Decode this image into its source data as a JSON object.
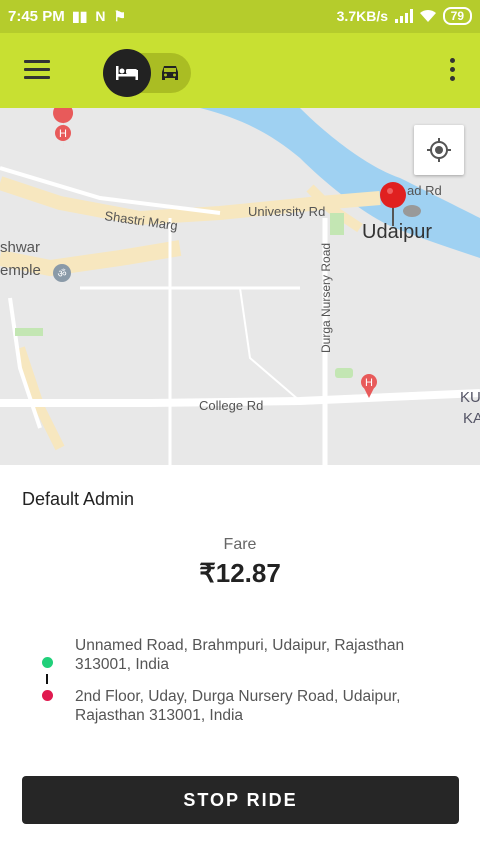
{
  "status_bar": {
    "time": "7:45 PM",
    "speed": "3.7KB/s",
    "battery": "79"
  },
  "app_bar": {
    "active_mode_icon": "bed-icon",
    "inactive_mode_icon": "taxi-icon"
  },
  "map": {
    "labels": {
      "shastri": "Shastri Marg",
      "university": "University Rd",
      "udaipur": "Udaipur",
      "durga": "Durga Nursery Road",
      "college": "College Rd",
      "rd_partial": "ad Rd",
      "hwar": "shwar",
      "emple": "emple",
      "ku": "KU",
      "ka": "KA"
    }
  },
  "ride": {
    "driver_name": "Default Admin",
    "fare_label": "Fare",
    "fare_value": "₹12.87",
    "pickup_address": "Unnamed Road, Brahmpuri, Udaipur, Rajasthan 313001, India",
    "drop_address": "2nd Floor, Uday, Durga Nursery Road, Udaipur, Rajasthan 313001, India",
    "stop_button_label": "STOP RIDE"
  },
  "colors": {
    "app_bar": "#c8e032",
    "status_bar": "#b5cc2c",
    "pickup": "#21d07a",
    "drop": "#e01a4f",
    "button": "#262626"
  }
}
